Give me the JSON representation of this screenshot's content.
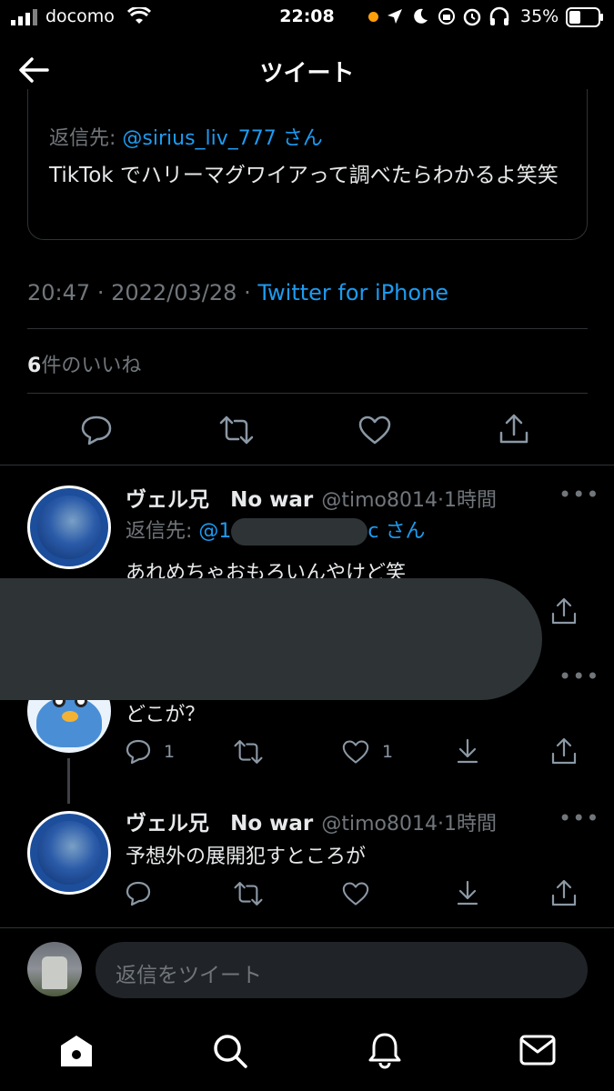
{
  "status": {
    "carrier": "docomo",
    "time": "22:08",
    "battery": "35%"
  },
  "header": {
    "title": "ツイート"
  },
  "quoted": {
    "reply_prefix": "返信先:",
    "reply_handle": "@sirius_liv_777",
    "reply_suffix": "さん",
    "text": "TikTok でハリーマグワイアって調べたらわかるよ笑笑"
  },
  "meta": {
    "time": "20:47",
    "date": "2022/03/28",
    "sep": "·",
    "source": "Twitter for iPhone"
  },
  "likes": {
    "count": "6",
    "label": "件のいいね"
  },
  "replies": [
    {
      "name": "ヴェル兄",
      "name_suffix": "No war",
      "handle": "@timo8014",
      "time": "1時間",
      "reply_prefix": "返信先:",
      "reply_handle_start": "@1",
      "reply_handle_end": "c",
      "reply_suffix": "さん",
      "text": "あれめちゃおもろいんやけど笑"
    },
    {
      "text": "どこが？",
      "reply_count": "1",
      "like_count": "1"
    },
    {
      "name": "ヴェル兄",
      "name_suffix": "No war",
      "handle": "@timo8014",
      "time": "1時間",
      "text": "予想外の展開犯すところが"
    }
  ],
  "compose": {
    "placeholder": "返信をツイート"
  },
  "colors": {
    "background": "#000000",
    "accent": "#1d9bf0",
    "muted": "#71767b",
    "divider": "#2f3336"
  }
}
